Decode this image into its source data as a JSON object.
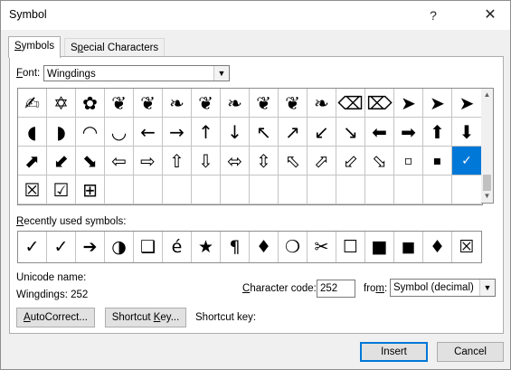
{
  "window": {
    "title": "Symbol",
    "help": "?",
    "close": "✕"
  },
  "tabs": {
    "symbols": "Symbols",
    "special": "Special Characters"
  },
  "font": {
    "label": "Font:",
    "value": "Wingdings"
  },
  "symbol_grid": {
    "rows": [
      [
        "✍",
        "✡",
        "✿",
        "❦",
        "❦",
        "❧",
        "❦",
        "❧",
        "❦",
        "❦",
        "❧",
        "⌫",
        "⌦",
        "➤",
        "➤",
        "➤"
      ],
      [
        "◖",
        "◗",
        "◠",
        "◡",
        "←",
        "→",
        "↑",
        "↓",
        "↖",
        "↗",
        "↙",
        "↘",
        "⬅",
        "➡",
        "⬆",
        "⬇"
      ],
      [
        "⬈",
        "⬋",
        "⬊",
        "⇦",
        "⇨",
        "⇧",
        "⇩",
        "⬄",
        "⇳",
        "⬁",
        "⬀",
        "⬃",
        "⬂",
        "▫",
        "▪",
        "✗"
      ],
      [
        "☒",
        "☑",
        "⊞",
        "",
        "",
        "",
        "",
        "",
        "",
        "",
        "",
        "",
        "",
        "",
        "",
        ""
      ]
    ],
    "selected_symbol": "✓"
  },
  "recent": {
    "label": "Recently used symbols:",
    "symbols": [
      "✓",
      "✓",
      "➔",
      "◑",
      "❑",
      "é",
      "★",
      "¶",
      "♦",
      "❍",
      "✂",
      "☐",
      "■",
      "◼",
      "♦",
      "☒",
      "→"
    ]
  },
  "unicode": {
    "name_label": "Unicode name:",
    "name_value": "Wingdings: 252"
  },
  "char_code": {
    "label": "Character code:",
    "value": "252"
  },
  "from": {
    "label": "from:",
    "value": "Symbol (decimal)"
  },
  "buttons": {
    "autocorrect": "AutoCorrect...",
    "shortcut_key": "Shortcut Key...",
    "insert": "Insert",
    "cancel": "Cancel"
  },
  "shortcut": {
    "label": "Shortcut key:"
  },
  "icons": {
    "scroll_up": "▲",
    "scroll_down": "▼",
    "dropdown": "▼"
  }
}
